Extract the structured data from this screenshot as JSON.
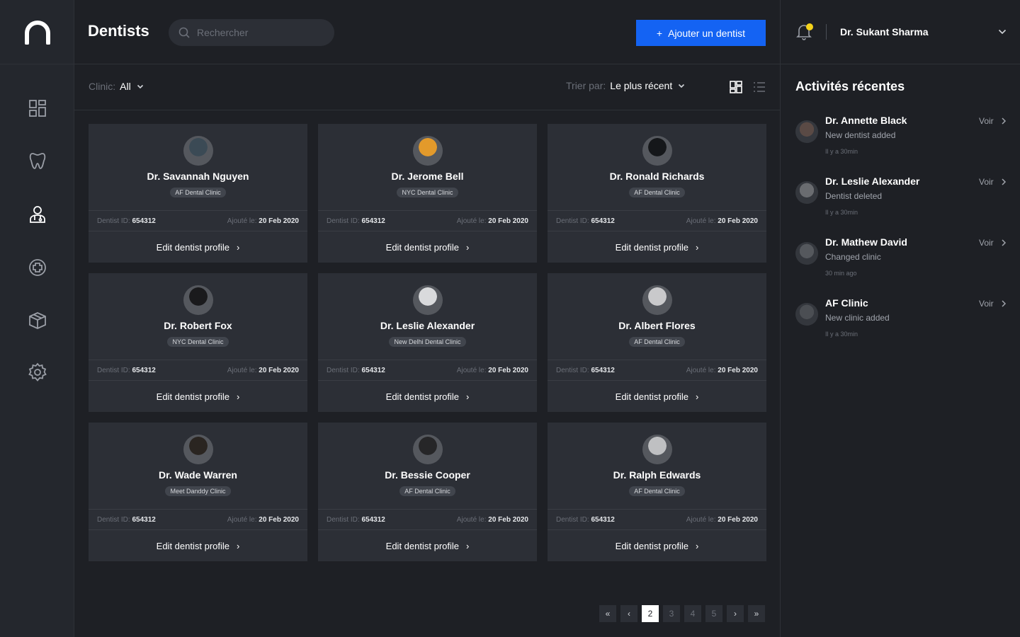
{
  "header": {
    "title": "Dentists",
    "search_placeholder": "Rechercher",
    "add_button": "Ajouter un dentist",
    "add_icon": "+"
  },
  "user": {
    "name": "Dr. Sukant Sharma"
  },
  "sidebar": {
    "items": [
      {
        "icon": "dashboard-icon"
      },
      {
        "icon": "tooth-icon"
      },
      {
        "icon": "dentist-user-icon"
      },
      {
        "icon": "medical-plus-icon"
      },
      {
        "icon": "box-icon"
      },
      {
        "icon": "settings-gear-icon"
      }
    ]
  },
  "filters": {
    "clinic_label": "Clinic:",
    "clinic_value": "All",
    "sort_label": "Trier par:",
    "sort_value": "Le plus récent"
  },
  "card_labels": {
    "id_label": "Dentist ID:",
    "added_label": "Ajouté le:",
    "edit_label": "Edit dentist profile",
    "edit_arrow": "›"
  },
  "dentists": [
    {
      "name": "Dr. Savannah Nguyen",
      "clinic": "AF Dental Clinic",
      "id": "654312",
      "date": "20 Feb 2020",
      "avatar_color": "#3b4a55"
    },
    {
      "name": "Dr. Jerome Bell",
      "clinic": "NYC Dental Clinic",
      "id": "654312",
      "date": "20 Feb 2020",
      "avatar_color": "#e39a2b"
    },
    {
      "name": "Dr. Ronald Richards",
      "clinic": "AF Dental Clinic",
      "id": "654312",
      "date": "20 Feb 2020",
      "avatar_color": "#15171a"
    },
    {
      "name": "Dr. Robert Fox",
      "clinic": "NYC Dental Clinic",
      "id": "654312",
      "date": "20 Feb 2020",
      "avatar_color": "#1a1a1c"
    },
    {
      "name": "Dr. Leslie Alexander",
      "clinic": "New Delhi Dental Clinic",
      "id": "654312",
      "date": "20 Feb 2020",
      "avatar_color": "#d9dadc"
    },
    {
      "name": "Dr. Albert Flores",
      "clinic": "AF Dental Clinic",
      "id": "654312",
      "date": "20 Feb 2020",
      "avatar_color": "#c9c9cb"
    },
    {
      "name": "Dr. Wade Warren",
      "clinic": "Meet Danddy Clinic",
      "id": "654312",
      "date": "20 Feb 2020",
      "avatar_color": "#2a2521"
    },
    {
      "name": "Dr. Bessie Cooper",
      "clinic": "AF Dental Clinic",
      "id": "654312",
      "date": "20 Feb 2020",
      "avatar_color": "#262628"
    },
    {
      "name": "Dr. Ralph Edwards",
      "clinic": "AF Dental Clinic",
      "id": "654312",
      "date": "20 Feb 2020",
      "avatar_color": "#bfc0c2"
    }
  ],
  "activities": {
    "title": "Activités récentes",
    "view_label": "Voir",
    "items": [
      {
        "name": "Dr. Annette Black",
        "desc": "New dentist added",
        "time": "Il y a 30min",
        "avatar_color": "#5a4a45"
      },
      {
        "name": "Dr. Leslie Alexander",
        "desc": "Dentist deleted",
        "time": "Il y a 30min",
        "avatar_color": "#6a6c70"
      },
      {
        "name": "Dr. Mathew David",
        "desc": "Changed clinic",
        "time": "30 min ago",
        "avatar_color": "#55585d"
      },
      {
        "name": "AF Clinic",
        "desc": "New clinic added",
        "time": "Il y a 30min",
        "avatar_color": "#4b4e53"
      }
    ]
  },
  "pagination": {
    "first": "«",
    "prev": "‹",
    "pages": [
      "2",
      "3",
      "4",
      "5"
    ],
    "active": "2",
    "next": "›",
    "last": "»"
  },
  "colors": {
    "accent": "#1463f3",
    "notification_dot": "#f4d21a",
    "background": "#1e2025",
    "card": "#2c2f36"
  }
}
